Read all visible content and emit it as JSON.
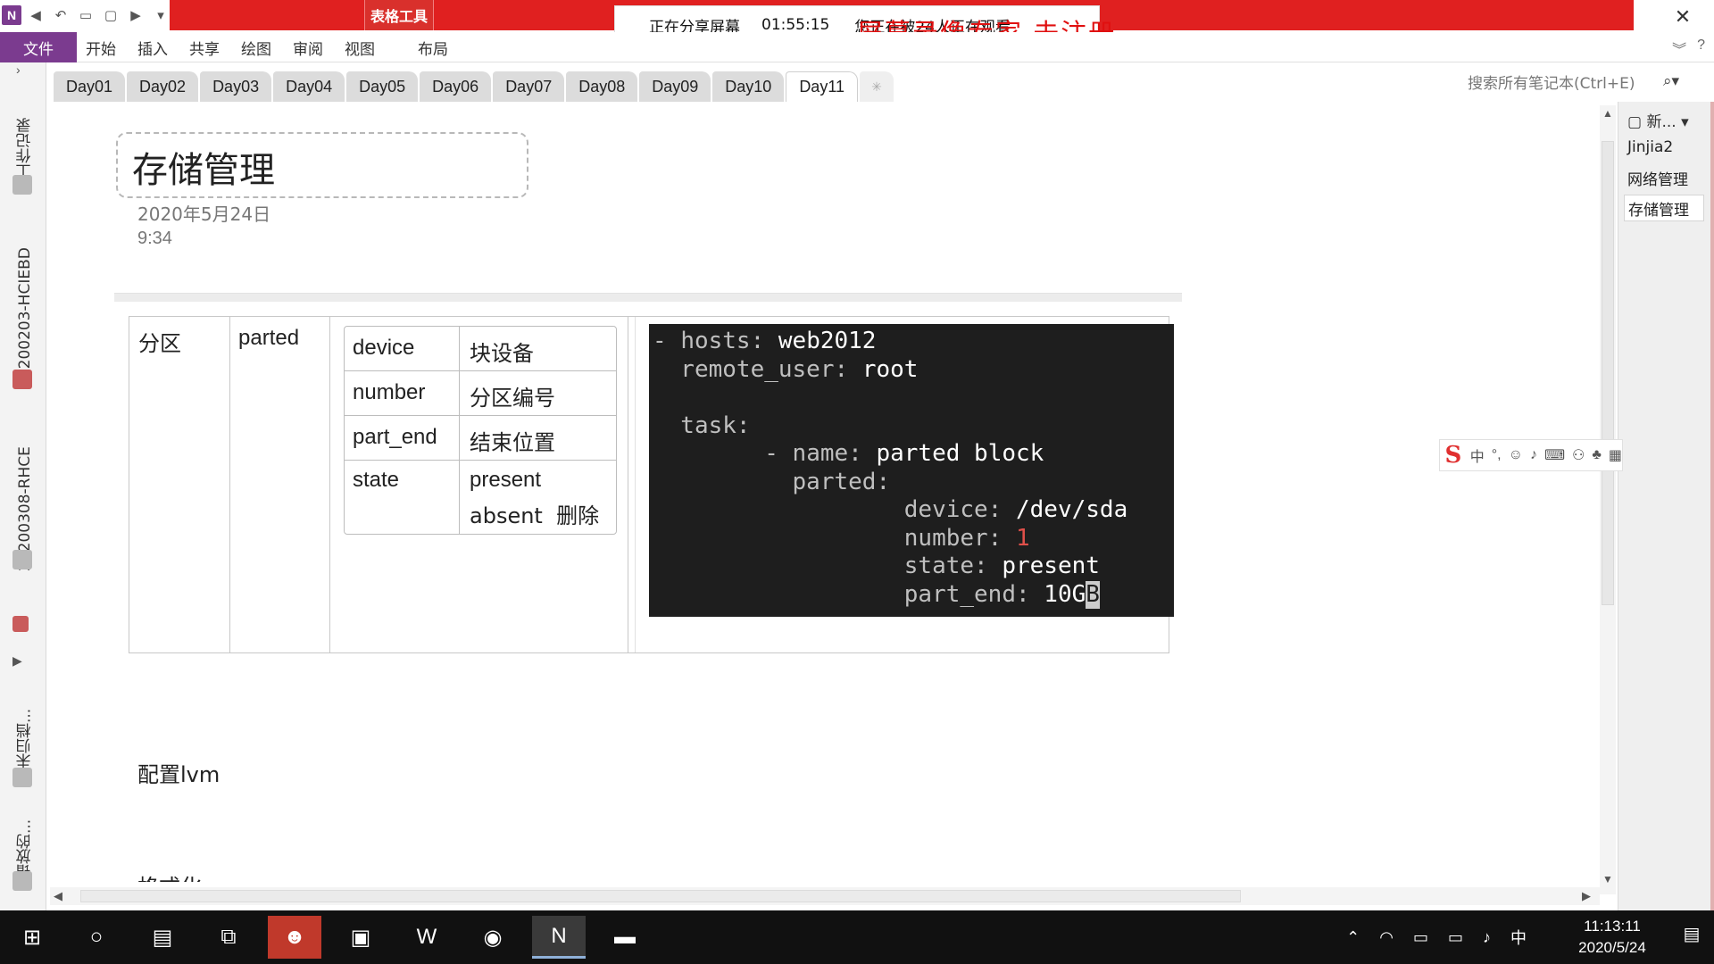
{
  "titlebar": {
    "context_tab": "表格工具",
    "share_status": "正在分享屏幕",
    "share_timer": "01:55:15",
    "share_viewers": "您正在被24人正在观看",
    "watermark": "屏幕录像专家 未注册",
    "close": "✕"
  },
  "ribbon": {
    "file": "文件",
    "tabs": [
      "开始",
      "插入",
      "共享",
      "绘图",
      "审阅",
      "视图"
    ],
    "layout": "布局"
  },
  "leftnav": {
    "notebooks": [
      "工作记录",
      "20200203-HCIEBD",
      "20200308-RHCE",
      "未归档...",
      "错放的..."
    ]
  },
  "sections": [
    "Day01",
    "Day02",
    "Day03",
    "Day04",
    "Day05",
    "Day06",
    "Day07",
    "Day08",
    "Day09",
    "Day10",
    "Day11"
  ],
  "active_section": "Day11",
  "search": {
    "placeholder": "搜索所有笔记本(Ctrl+E)"
  },
  "page": {
    "title": "存储管理",
    "date": "2020年5月24日",
    "time": "9:34",
    "table": {
      "col1": "分区",
      "col2": "parted",
      "params": [
        {
          "key": "device",
          "value": "块设备"
        },
        {
          "key": "number",
          "value": "分区编号"
        },
        {
          "key": "part_end",
          "value": "结束位置"
        },
        {
          "key": "state",
          "value": "present",
          "value2": "absent  删除"
        }
      ],
      "code": {
        "l1a": "- ",
        "l1b": "hosts: ",
        "l1c": "web2012",
        "l2a": "  remote_user: ",
        "l2b": "root",
        "l3": "  task:",
        "l4a": "        - ",
        "l4b": "name: ",
        "l4c": "parted block",
        "l5": "          parted:",
        "l6a": "                  device: ",
        "l6b": "/dev/sda",
        "l7a": "                  number: ",
        "l7b": "1",
        "l8a": "                  state: ",
        "l8b": "present",
        "l9a": "                  part_end: ",
        "l9b": "10G",
        "l9c": "B"
      }
    },
    "lvm_heading": "配置lvm",
    "cut_text": "格式化"
  },
  "pagelist": {
    "new_page": "新...",
    "pages": [
      "Jinjia2",
      "网络管理",
      "存储管理"
    ],
    "active_page": "存储管理"
  },
  "ime": {
    "logo": "S",
    "mode": "中"
  },
  "taskbar": {
    "tray_ime": "中",
    "time": "11:13:11",
    "date": "2020/5/24"
  },
  "colors": {
    "share_band": "#e02020",
    "onenote_purple": "#7b3b8f",
    "code_bg": "#1e1e1e",
    "code_number": "#e0504a",
    "watermark": "#e01010"
  }
}
